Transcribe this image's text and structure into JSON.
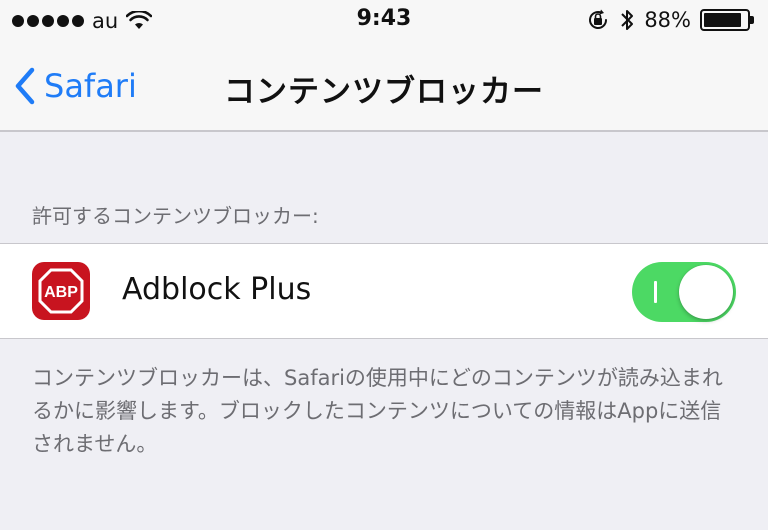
{
  "status_bar": {
    "carrier": "au",
    "time": "9:43",
    "battery_percent": "88%",
    "battery_level": 0.88
  },
  "nav": {
    "back_label": "Safari",
    "title": "コンテンツブロッカー"
  },
  "section": {
    "header": "許可するコンテンツブロッカー:",
    "items": [
      {
        "icon_text": "ABP",
        "label": "Adblock Plus",
        "enabled": true
      }
    ]
  },
  "footer": {
    "text": "コンテンツブロッカーは、Safariの使用中にどのコンテンツが読み込まれるかに影響します。ブロックしたコンテンツについての情報はAppに送信されません。"
  },
  "colors": {
    "accent": "#1f7cf7",
    "toggle_on": "#4cd964",
    "abp_red": "#c8141f"
  }
}
